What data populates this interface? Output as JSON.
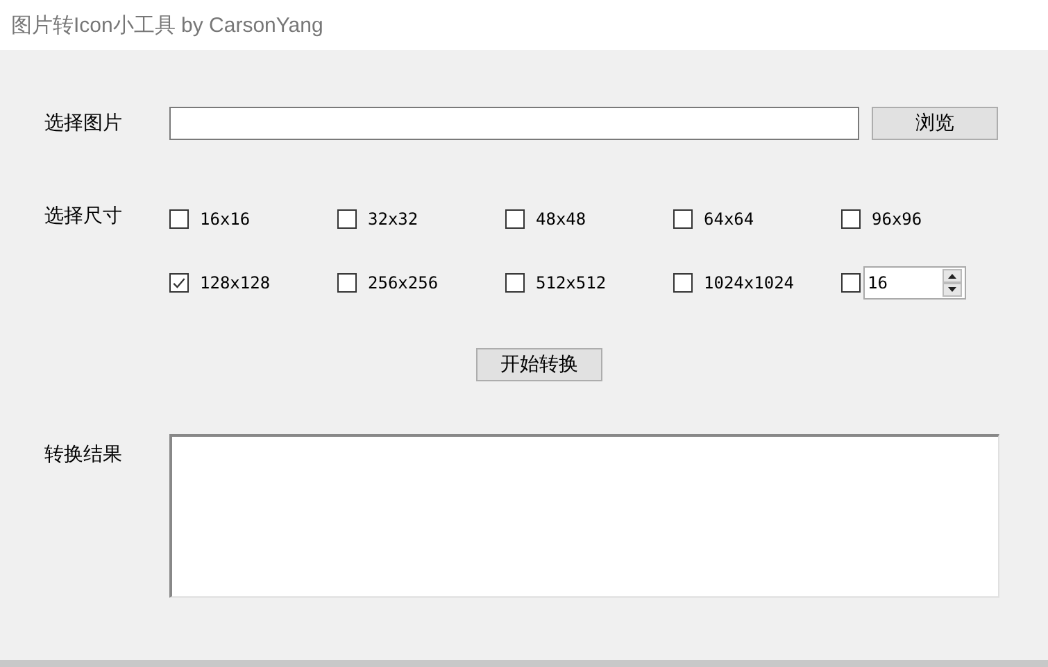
{
  "window": {
    "title": "图片转Icon小工具 by CarsonYang"
  },
  "image_picker": {
    "label": "选择图片",
    "button": "浏览"
  },
  "sizes": {
    "label": "选择尺寸",
    "options": [
      {
        "label": "16x16",
        "checked": false
      },
      {
        "label": "32x32",
        "checked": false
      },
      {
        "label": "48x48",
        "checked": false
      },
      {
        "label": "64x64",
        "checked": false
      },
      {
        "label": "96x96",
        "checked": false
      },
      {
        "label": "128x128",
        "checked": true
      },
      {
        "label": "256x256",
        "checked": false
      },
      {
        "label": "512x512",
        "checked": false
      },
      {
        "label": "1024x1024",
        "checked": false
      }
    ],
    "custom": {
      "checked": false,
      "value": "16"
    }
  },
  "start_button": "开始转换",
  "result": {
    "label": "转换结果"
  }
}
